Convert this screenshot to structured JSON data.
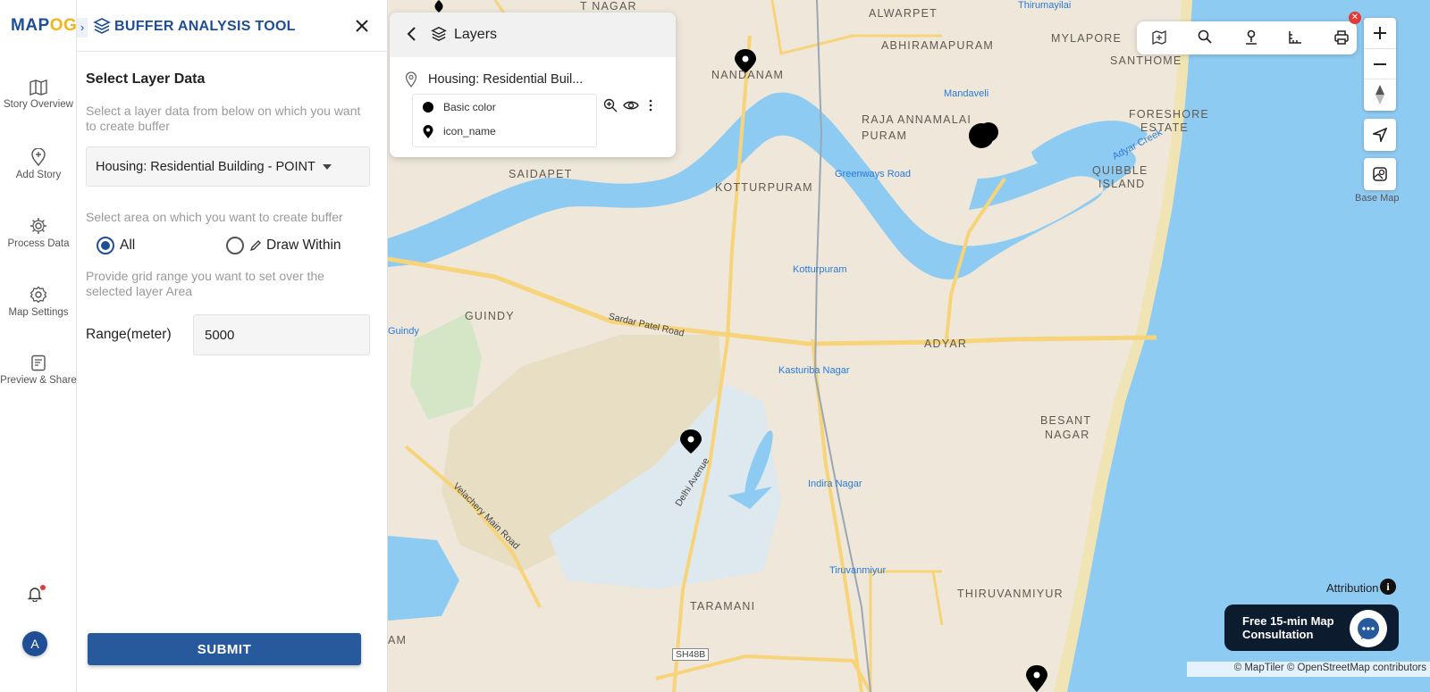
{
  "app": {
    "logo_main": "MAP",
    "logo_accent": "OG"
  },
  "rail": {
    "items": [
      {
        "label": "Story Overview",
        "icon": "map-icon"
      },
      {
        "label": "Add Story",
        "icon": "add-location-icon"
      },
      {
        "label": "Process Data",
        "icon": "gear-process-icon"
      },
      {
        "label": "Map Settings",
        "icon": "gear-icon"
      },
      {
        "label": "Preview & Share",
        "icon": "preview-icon"
      }
    ],
    "avatar_initial": "A"
  },
  "panel": {
    "title": "BUFFER ANALYSIS TOOL",
    "select_heading": "Select Layer Data",
    "select_help": "Select a layer data from below on which you want to create buffer",
    "selected_layer": "Housing: Residential Building - POINT",
    "area_help": "Select area on which you want to create buffer",
    "radio_all": "All",
    "radio_draw": "Draw Within",
    "radio_selected": "All",
    "grid_help": "Provide grid range you want to set over the selected layer Area",
    "range_label": "Range(meter)",
    "range_value": "5000",
    "submit_label": "SUBMIT"
  },
  "layers": {
    "title": "Layers",
    "layer_name": "Housing: Residential Buil...",
    "legend": [
      {
        "label": "Basic color"
      },
      {
        "label": "icon_name"
      }
    ]
  },
  "map": {
    "labels": {
      "tnagar": "T NAGAR",
      "alwarpet": "ALWARPET",
      "thirumayilai": "Thirumayilai",
      "abhiramapuram": "ABHIRAMAPURAM",
      "mylapore": "MYLAPORE",
      "nandanam": "NANDANAM",
      "santhome": "SANTHOME",
      "mandaveli": "Mandaveli",
      "raja": "RAJA ANNAMALAI",
      "puram": "PURAM",
      "foreshore1": "FORESHORE",
      "foreshore2": "ESTATE",
      "saidapet": "SAIDAPET",
      "greenways": "Greenways Road",
      "kotturpuram": "KOTTURPURAM",
      "quibble1": "QUIBBLE",
      "quibble2": "ISLAND",
      "adyar_creek": "Adyar Creek",
      "kotturpuram_st": "Kotturpuram",
      "guindy": "GUINDY",
      "guindy_st": "Guindy",
      "sardar": "Sardar Patel Road",
      "adyar": "ADYAR",
      "kasturiba": "Kasturiba Nagar",
      "besant1": "BESANT",
      "besant2": "NAGAR",
      "delhi_ave": "Delhi Avenue",
      "velachery": "Velachery Main Road",
      "indira": "Indira Nagar",
      "tiruvanmiyur_st": "Tiruvanmiyur",
      "thiruvanmiyur": "THIRUVANMIYUR",
      "taramani": "TARAMANI",
      "sh48b": "SH48B",
      "am": "AM"
    },
    "basemap_label": "Base Map",
    "attribution_label": "Attribution",
    "consult_text": "Free 15-min Map Consultation",
    "copyright": "© MapTiler © OpenStreetMap contributors"
  },
  "colors": {
    "brand": "#1f4e96",
    "brand_accent": "#f2b418",
    "water": "#8ecbf2",
    "land": "#eee7da",
    "road": "#f7d47a"
  }
}
